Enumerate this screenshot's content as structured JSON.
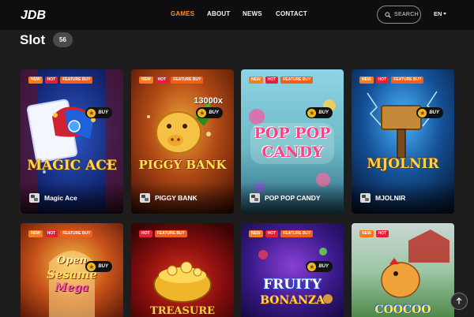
{
  "header": {
    "logo_text": "JDB",
    "nav": [
      {
        "label": "GAMES",
        "active": true
      },
      {
        "label": "ABOUT",
        "active": false
      },
      {
        "label": "NEWS",
        "active": false
      },
      {
        "label": "CONTACT",
        "active": false
      }
    ],
    "search_label": "SEARCH",
    "language": "EN"
  },
  "section": {
    "title": "Slot",
    "count": "56"
  },
  "tag_labels": {
    "new": "NEW",
    "hot": "HOT",
    "feature": "FEATURE BUY"
  },
  "buy_label": "BUY",
  "games": [
    {
      "name": "Magic Ace",
      "tags": [
        "NEW",
        "HOT",
        "FEATURE BUY"
      ],
      "buy": true,
      "art_text": "MAGIC ACE"
    },
    {
      "name": "PIGGY BANK",
      "tags": [
        "NEW",
        "HOT",
        "FEATURE BUY"
      ],
      "buy": true,
      "art_text": "PIGGY BANK",
      "multiplier": "13000x"
    },
    {
      "name": "POP POP CANDY",
      "tags": [
        "NEW",
        "HOT",
        "FEATURE BUY"
      ],
      "buy": true,
      "art_text_1": "POP POP",
      "art_text_2": "CANDY"
    },
    {
      "name": "MJOLNIR",
      "tags": [
        "NEW",
        "HOT",
        "FEATURE BUY"
      ],
      "buy": true,
      "art_text": "MJOLNIR"
    },
    {
      "name": "Open Sesame Mega",
      "tags": [
        "NEW",
        "HOT",
        "FEATURE BUY"
      ],
      "buy": true,
      "art_text_1": "Open",
      "art_text_2": "Sesame",
      "art_text_3": "Mega"
    },
    {
      "name": "TREASURE",
      "tags": [
        "HOT",
        "FEATURE BUY"
      ],
      "buy": false,
      "art_text": "TREASURE"
    },
    {
      "name": "FRUITY BONANZA",
      "tags": [
        "NEW",
        "HOT",
        "FEATURE BUY"
      ],
      "buy": true,
      "art_text_1": "FRUITY",
      "art_text_2": "BONANZA"
    },
    {
      "name": "COOCOO",
      "tags": [
        "NEW",
        "HOT"
      ],
      "buy": false,
      "art_text": "COOCOO"
    }
  ],
  "colors": {
    "accent": "#ff8a2a",
    "tag_new": "#ff7a1a",
    "tag_hot": "#e32035",
    "tag_feature": "#f25e1c",
    "coin": "#f2b820"
  }
}
